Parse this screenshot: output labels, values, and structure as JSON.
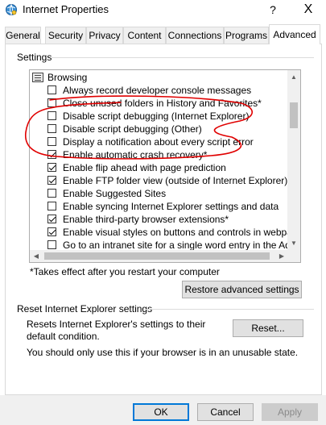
{
  "window": {
    "title": "Internet Properties",
    "help_glyph": "?",
    "close_glyph": "X"
  },
  "tabs": [
    {
      "label": "General"
    },
    {
      "label": "Security"
    },
    {
      "label": "Privacy"
    },
    {
      "label": "Content"
    },
    {
      "label": "Connections"
    },
    {
      "label": "Programs"
    },
    {
      "label": "Advanced",
      "active": true
    }
  ],
  "settings": {
    "group_label": "Settings",
    "category": "Browsing",
    "items": [
      {
        "label": "Always record developer console messages",
        "checked": false
      },
      {
        "label": "Close unused folders in History and Favorites*",
        "checked": false
      },
      {
        "label": "Disable script debugging (Internet Explorer)",
        "checked": false
      },
      {
        "label": "Disable script debugging (Other)",
        "checked": false
      },
      {
        "label": "Display a notification about every script error",
        "checked": false
      },
      {
        "label": "Enable automatic crash recovery*",
        "checked": true
      },
      {
        "label": "Enable flip ahead with page prediction",
        "checked": true
      },
      {
        "label": "Enable FTP folder view (outside of Internet Explorer)",
        "checked": true
      },
      {
        "label": "Enable Suggested Sites",
        "checked": false
      },
      {
        "label": "Enable syncing Internet Explorer settings and data",
        "checked": false
      },
      {
        "label": "Enable third-party browser extensions*",
        "checked": true
      },
      {
        "label": "Enable visual styles on buttons and controls in webpages",
        "checked": true
      },
      {
        "label": "Go to an intranet site for a single word entry in the Address",
        "checked": false
      }
    ],
    "note": "*Takes effect after you restart your computer",
    "restore_button": "Restore advanced settings"
  },
  "reset": {
    "group_label": "Reset Internet Explorer settings",
    "description": "Resets Internet Explorer's settings to their default condition.",
    "button": "Reset...",
    "warning": "You should only use this if your browser is in an unusable state."
  },
  "footer": {
    "ok": "OK",
    "cancel": "Cancel",
    "apply": "Apply"
  },
  "colors": {
    "annotation": "#e00000",
    "accent": "#0078d7"
  }
}
